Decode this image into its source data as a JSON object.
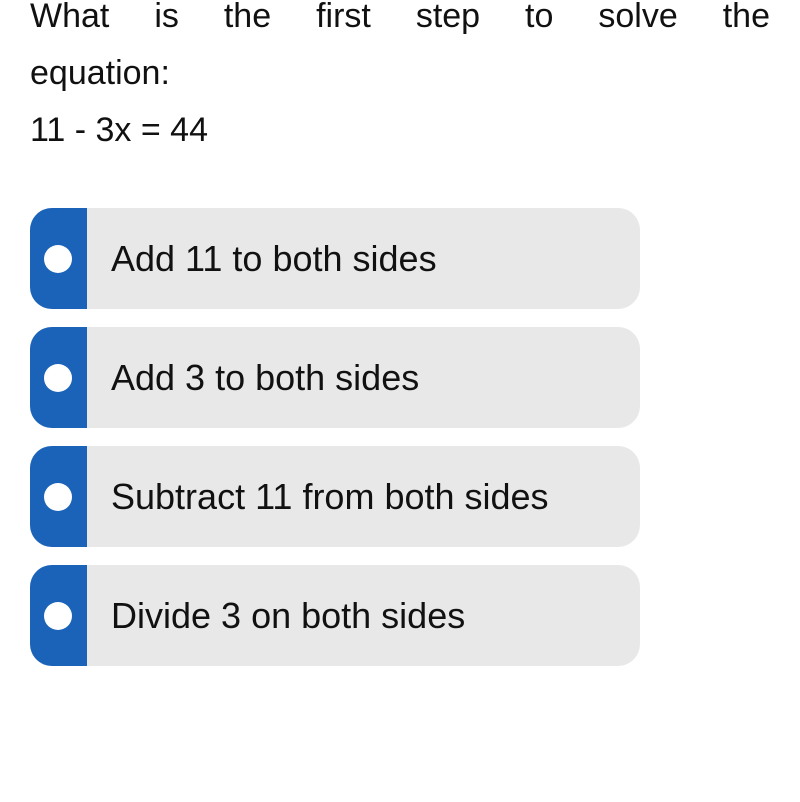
{
  "question": {
    "line1": "What is the first step to solve the",
    "line2": "equation:",
    "equation": "11 - 3x = 44"
  },
  "options": [
    {
      "label": "Add 11 to both sides",
      "icon": "radio-dot-icon"
    },
    {
      "label": "Add 3 to both sides",
      "icon": "radio-dot-icon"
    },
    {
      "label": "Subtract 11 from both sides",
      "icon": "radio-dot-icon"
    },
    {
      "label": "Divide 3 on both sides",
      "icon": "radio-dot-icon"
    }
  ],
  "colors": {
    "accent": "#1a63b8",
    "option_bg": "#e8e8e8"
  }
}
